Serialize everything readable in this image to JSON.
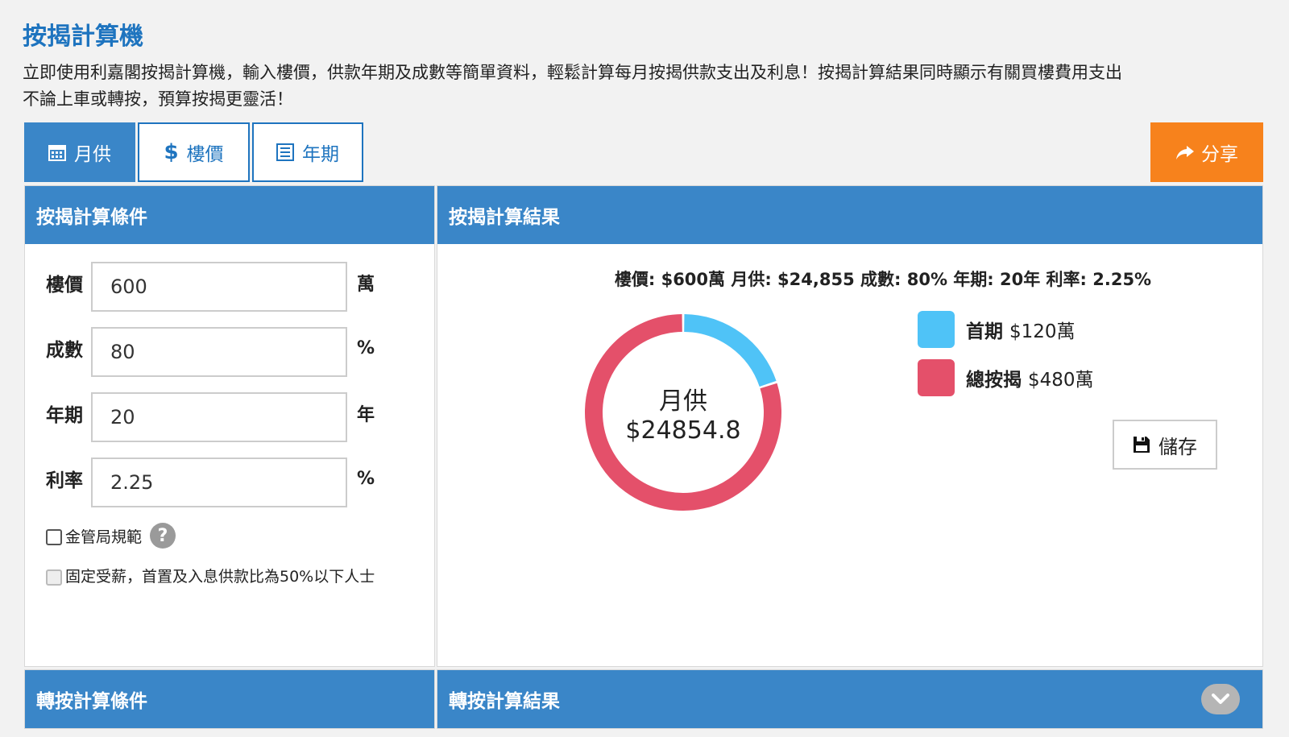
{
  "page": {
    "title": "按揭計算機",
    "intro_line1": "立即使用利嘉閣按揭計算機，輸入樓價，供款年期及成數等簡單資料，輕鬆計算每月按揭供款支出及利息！按揭計算結果同時顯示有關買樓費用支出",
    "intro_line2": "不論上車或轉按，預算按揭更靈活！"
  },
  "tabs": [
    {
      "label": "月供",
      "icon": "calendar-icon",
      "active": true
    },
    {
      "label": "樓價",
      "icon": "dollar-icon",
      "active": false
    },
    {
      "label": "年期",
      "icon": "list-icon",
      "active": false
    }
  ],
  "share_label": "分享",
  "conditions": {
    "header": "按揭計算條件",
    "fields": [
      {
        "label": "樓價",
        "value": "600",
        "unit": "萬"
      },
      {
        "label": "成數",
        "value": "80",
        "unit": "%"
      },
      {
        "label": "年期",
        "value": "20",
        "unit": "年"
      },
      {
        "label": "利率",
        "value": "2.25",
        "unit": "%"
      }
    ],
    "hkma_label": "金管局規範",
    "help_glyph": "?",
    "fixed_income_label": "固定受薪，首置及入息供款比為50%以下人士"
  },
  "results": {
    "header": "按揭計算結果",
    "summary": "樓價: $600萬 月供: $24,855 成數: 80% 年期: 20年 利率: 2.25%",
    "center_label": "月供",
    "center_value": "$24854.8",
    "legend": [
      {
        "name": "首期",
        "value": "$120萬",
        "color": "#4fc3f7",
        "amount": 120
      },
      {
        "name": "總按揭",
        "value": "$480萬",
        "color": "#e4506a",
        "amount": 480
      }
    ],
    "save_label": "儲存"
  },
  "refi": {
    "conditions_header": "轉按計算條件",
    "results_header": "轉按計算結果"
  },
  "colors": {
    "primary": "#3a86c8",
    "title": "#1e74bf",
    "share": "#f7821c"
  }
}
